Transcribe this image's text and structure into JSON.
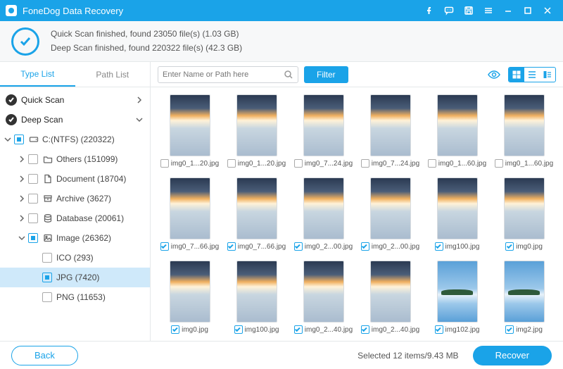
{
  "app": {
    "title": "FoneDog Data Recovery"
  },
  "status": {
    "line1": "Quick Scan finished, found 23050 file(s) (1.03 GB)",
    "line2": "Deep Scan finished, found 220322 file(s) (42.3 GB)"
  },
  "sidebar": {
    "tab_type": "Type List",
    "tab_path": "Path List",
    "quick_scan": "Quick Scan",
    "deep_scan": "Deep Scan",
    "drive": "C:(NTFS) (220322)",
    "others": "Others (151099)",
    "document": "Document (18704)",
    "archive": "Archive (3627)",
    "database": "Database (20061)",
    "image": "Image (26362)",
    "ico": "ICO (293)",
    "jpg": "JPG (7420)",
    "png": "PNG (11653)"
  },
  "toolbar": {
    "search_placeholder": "Enter Name or Path here",
    "filter": "Filter"
  },
  "grid": {
    "items": [
      {
        "name": "img0_1...20.jpg",
        "checked": false,
        "style": "sunset"
      },
      {
        "name": "img0_1...20.jpg",
        "checked": false,
        "style": "sunset"
      },
      {
        "name": "img0_7...24.jpg",
        "checked": false,
        "style": "sunset"
      },
      {
        "name": "img0_7...24.jpg",
        "checked": false,
        "style": "sunset"
      },
      {
        "name": "img0_1...60.jpg",
        "checked": false,
        "style": "sunset"
      },
      {
        "name": "img0_1...60.jpg",
        "checked": false,
        "style": "sunset"
      },
      {
        "name": "img0_7...66.jpg",
        "checked": true,
        "style": "sunset"
      },
      {
        "name": "img0_7...66.jpg",
        "checked": true,
        "style": "sunset"
      },
      {
        "name": "img0_2...00.jpg",
        "checked": true,
        "style": "sunset"
      },
      {
        "name": "img0_2...00.jpg",
        "checked": true,
        "style": "sunset"
      },
      {
        "name": "img100.jpg",
        "checked": true,
        "style": "sunset"
      },
      {
        "name": "img0.jpg",
        "checked": true,
        "style": "sunset"
      },
      {
        "name": "img0.jpg",
        "checked": true,
        "style": "sunset"
      },
      {
        "name": "img100.jpg",
        "checked": true,
        "style": "sunset"
      },
      {
        "name": "img0_2...40.jpg",
        "checked": true,
        "style": "sunset"
      },
      {
        "name": "img0_2...40.jpg",
        "checked": true,
        "style": "sunset"
      },
      {
        "name": "img102.jpg",
        "checked": true,
        "style": "island"
      },
      {
        "name": "img2.jpg",
        "checked": true,
        "style": "island"
      }
    ]
  },
  "footer": {
    "back": "Back",
    "selected": "Selected 12 items/9.43 MB",
    "recover": "Recover"
  }
}
